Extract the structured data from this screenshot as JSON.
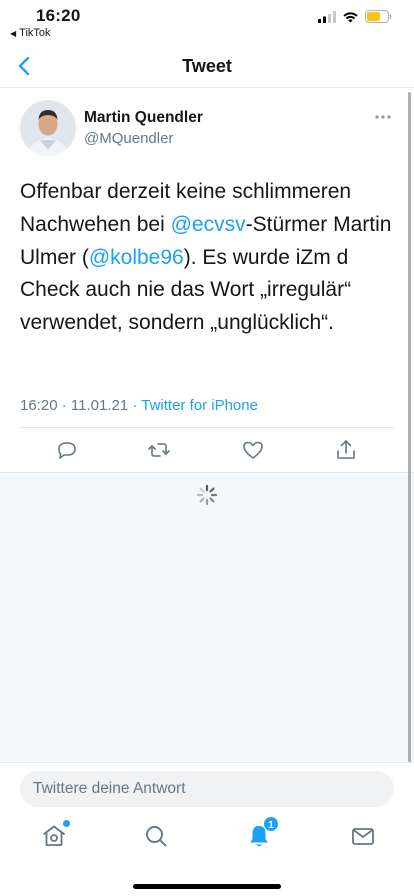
{
  "status_bar": {
    "time": "16:20",
    "back_app": "TikTok",
    "battery_color": "#f5c518"
  },
  "nav": {
    "title": "Tweet",
    "back_icon": "chevron-left-icon"
  },
  "tweet": {
    "author_name": "Martin Quendler",
    "author_handle": "@MQuendler",
    "text_parts": {
      "p1": "Offenbar derzeit keine schlimmeren Nachwehen bei ",
      "m1": "@ecvsv",
      "p2": "-Stürmer Martin Ulmer (",
      "m2": "@kolbe96",
      "p3": "). Es wurde iZm d Check auch nie das Wort „irregulär“ verwendet, sondern „unglücklich“."
    },
    "time": "16:20",
    "sep1": " · ",
    "date": "11.01.21",
    "sep2": " · ",
    "source": "Twitter for iPhone",
    "actions": [
      "reply-icon",
      "retweet-icon",
      "like-icon",
      "share-icon"
    ]
  },
  "reply": {
    "placeholder": "Twittere deine Antwort"
  },
  "tabs": {
    "items": [
      "home-icon",
      "search-icon",
      "notifications-icon",
      "messages-icon"
    ],
    "notifications_badge": "1"
  },
  "colors": {
    "accent": "#1da1f2",
    "text": "#14171a",
    "secondary": "#657786"
  }
}
